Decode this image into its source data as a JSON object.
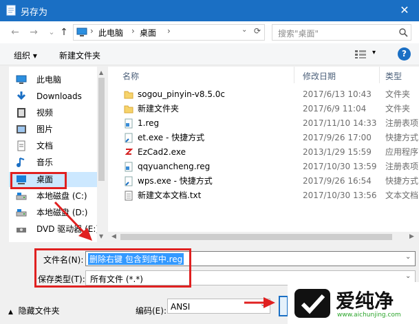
{
  "window": {
    "title": "另存为",
    "close": "✕"
  },
  "nav": {
    "back": "←",
    "forward": "→",
    "dropdown": "⌄",
    "up": "↑",
    "breadcrumb": [
      "此电脑",
      "桌面"
    ],
    "refresh": "⟳",
    "search_placeholder": "搜索\"桌面\""
  },
  "toolbar": {
    "organize": "组织",
    "new_folder": "新建文件夹",
    "help": "?"
  },
  "sidebar": {
    "items": [
      {
        "label": "此电脑",
        "icon": "pc-icon"
      },
      {
        "label": "Downloads",
        "icon": "download-icon"
      },
      {
        "label": "视频",
        "icon": "video-icon"
      },
      {
        "label": "图片",
        "icon": "picture-icon"
      },
      {
        "label": "文档",
        "icon": "document-icon"
      },
      {
        "label": "音乐",
        "icon": "music-icon"
      },
      {
        "label": "桌面",
        "icon": "desktop-icon",
        "selected": true
      },
      {
        "label": "本地磁盘 (C:)",
        "icon": "drive-icon"
      },
      {
        "label": "本地磁盘 (D:)",
        "icon": "drive-icon"
      },
      {
        "label": "DVD 驱动器 (E:)",
        "icon": "dvd-icon"
      }
    ]
  },
  "filelist": {
    "headers": {
      "name": "名称",
      "date": "修改日期",
      "type": "类型"
    },
    "rows": [
      {
        "name": "sogou_pinyin-v8.5.0c",
        "date": "2017/6/13 10:43",
        "type": "文件夹",
        "icon": "folder-icon"
      },
      {
        "name": "新建文件夹",
        "date": "2017/6/9 11:04",
        "type": "文件夹",
        "icon": "folder-icon"
      },
      {
        "name": "1.reg",
        "date": "2017/11/10 14:33",
        "type": "注册表项",
        "icon": "reg-file-icon"
      },
      {
        "name": "et.exe - 快捷方式",
        "date": "2017/9/26 17:00",
        "type": "快捷方式",
        "icon": "shortcut-icon"
      },
      {
        "name": "EzCad2.exe",
        "date": "2013/1/29 15:59",
        "type": "应用程序",
        "icon": "ezcad-icon"
      },
      {
        "name": "qqyuancheng.reg",
        "date": "2017/10/30 13:59",
        "type": "注册表项",
        "icon": "reg-file-icon"
      },
      {
        "name": "wps.exe - 快捷方式",
        "date": "2017/9/26 16:54",
        "type": "快捷方式",
        "icon": "shortcut-icon"
      },
      {
        "name": "新建文本文档.txt",
        "date": "2017/10/30 13:56",
        "type": "文本文档",
        "icon": "text-file-icon"
      }
    ]
  },
  "form": {
    "filename_label": "文件名(N):",
    "filename_value": "删除右键 包含到库中.reg",
    "filetype_label": "保存类型(T):",
    "filetype_value": "所有文件  (*.*)",
    "hide_folders": "隐藏文件夹",
    "encoding_label": "编码(E):",
    "encoding_value": "ANSI"
  },
  "watermark": {
    "brand": "爱纯净",
    "url": "www.aichunjing.com"
  },
  "colors": {
    "titlebar": "#1a6fc4",
    "selection": "#cce8ff",
    "annotation": "#e02020",
    "highlight": "#3399ff"
  }
}
